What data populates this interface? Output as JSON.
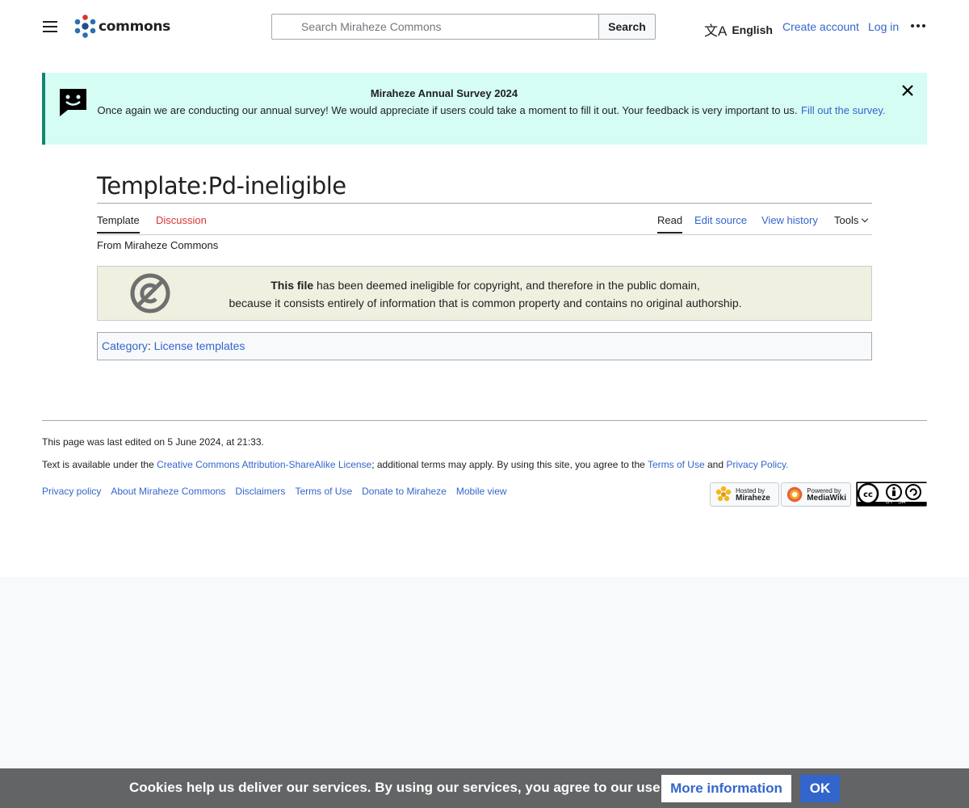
{
  "header": {
    "logo_text": "commons",
    "search_placeholder": "Search Miraheze Commons",
    "search_button": "Search",
    "language": "English",
    "create_account": "Create account",
    "login": "Log in",
    "icons": {
      "menu": "hamburger-menu-icon",
      "search": "search-icon",
      "language": "translate-icon",
      "more": "ellipsis-icon"
    }
  },
  "banner": {
    "title": "Miraheze Annual Survey 2024",
    "text": "Once again we are conducting our annual survey! We would appreciate if users could take a moment to fill it out. Your feedback is very important to us.",
    "link": "Fill out the survey.",
    "icon": "speech-bubble-smile-icon",
    "close_icon": "close-icon"
  },
  "page": {
    "title": "Template:Pd-ineligible",
    "tagline": "From Miraheze Commons",
    "tabs_left": [
      "Template",
      "Discussion"
    ],
    "tabs_right": [
      "Read",
      "Edit source",
      "View history",
      "Tools"
    ]
  },
  "license": {
    "bold_lead": "This file",
    "line1_rest": " has been deemed ineligible for copyright, and therefore in the public domain,",
    "line2": "because it consists entirely of information that is common property and contains no original authorship.",
    "icon": "public-domain-icon"
  },
  "category": {
    "label": "Category",
    "separator": ": ",
    "item": "License templates"
  },
  "footer": {
    "last_edited": "This page was last edited on 5 June 2024, at 21:33.",
    "license_prefix": "Text is available under the ",
    "license_link": "Creative Commons Attribution-ShareAlike License",
    "license_mid": "; additional terms may apply. By using this site, you agree to the ",
    "terms_link": "Terms of Use",
    "and": " and ",
    "privacy_link": "Privacy Policy.",
    "links": [
      "Privacy policy",
      "About Miraheze Commons",
      "Disclaimers",
      "Terms of Use",
      "Donate to Miraheze",
      "Mobile view"
    ],
    "badge_hosted_top": "Hosted by",
    "badge_hosted_bottom": "Miraheze",
    "badge_mw_top": "Powered by",
    "badge_mw_bottom": "MediaWiki",
    "cc_badge_text": "BY   SA"
  },
  "cookie": {
    "text": "Cookies help us deliver our services. By using our services, you agree to our use of cookies.",
    "more": "More information",
    "ok": "OK"
  },
  "colors": {
    "link": "#3366cc",
    "new_link": "#dd3333",
    "banner_bg": "#d5fdf4",
    "banner_border": "#14866d",
    "license_bg": "#f0f0e1",
    "cookie_bg": "#626465"
  }
}
